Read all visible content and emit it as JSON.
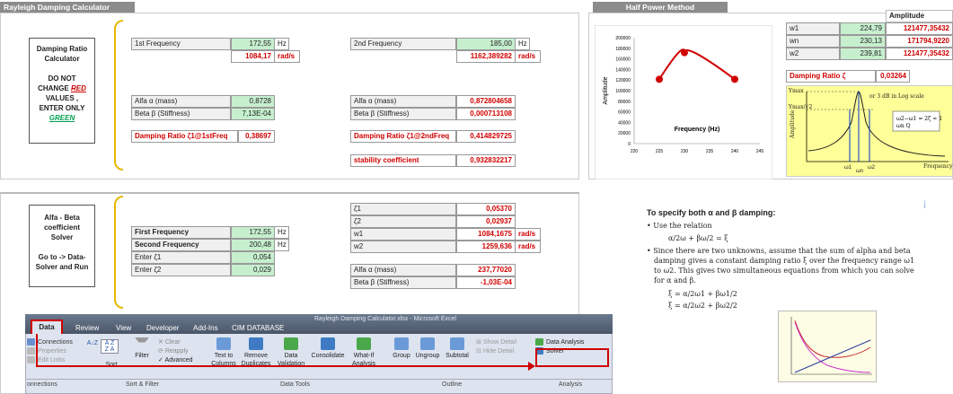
{
  "top_left": {
    "title": "Rayleigh Damping Calculator",
    "desc": [
      "Damping Ratio",
      "Calculator",
      "",
      "DO NOT",
      "CHANGE",
      "RED",
      "VALUES ,",
      "ENTER ONLY",
      "GREEN"
    ],
    "f1_label": "1st Frequency",
    "f1_val": "172,55",
    "f1_unit": "Hz",
    "f1_rad": "1084,17",
    "f1_rad_unit": "rad/s",
    "alpha_label": "Alfa α (mass)",
    "alpha_val": "0,8728",
    "beta_label": "Beta β (Stiffness)",
    "beta_val": "7,13E-04",
    "dr_label": "Damping Ratio ζ1@1stFreq",
    "dr_val": "0,38697",
    "f2_label": "2nd Frequency",
    "f2_val": "185,00",
    "f2_unit": "Hz",
    "f2_rad": "1162,389282",
    "f2_rad_unit": "rad/s",
    "alpha2_label": "Alfa α (mass)",
    "alpha2_val": "0,872804658",
    "beta2_label": "Beta β (Stiffness)",
    "beta2_val": "0,000713108",
    "dr2_label": "Damping Ratio ζ1@2ndFreq",
    "dr2_val": "0,414829725",
    "stab_label": "stability coefficient",
    "stab_val": "0,932832217"
  },
  "half_power": {
    "title": "Half Power Method",
    "amp_header": "Amplitude",
    "rows": [
      {
        "k": "w1",
        "v": "224,79",
        "a": "121477,35432"
      },
      {
        "k": "wn",
        "v": "230,13",
        "a": "171794,9220"
      },
      {
        "k": "w2",
        "v": "239,81",
        "a": "121477,35432"
      }
    ],
    "dr_label": "Damping Ratio ζ",
    "dr_val": "0,03264"
  },
  "chart_data": {
    "type": "line",
    "x": [
      225,
      230,
      240
    ],
    "y": [
      121477.35,
      171794.92,
      121477.35
    ],
    "xlabel": "Frequency (Hz)",
    "ylabel": "Amplitude",
    "xticks": [
      "220",
      "225",
      "230",
      "235",
      "240",
      "245"
    ],
    "yticks": [
      "200000",
      "180000",
      "160000",
      "140000",
      "120000",
      "100000",
      "80000",
      "60000",
      "40000",
      "20000",
      "0"
    ],
    "xlim": [
      220,
      245
    ],
    "ylim": [
      0,
      200000
    ],
    "color": "#d00000"
  },
  "resonance": {
    "ymax": "Ymax",
    "ymax_sqrt": "Ymax/√2",
    "note": "or 3 dB in Log scale",
    "yaxis": "Amplitude",
    "xaxis": "Frequency",
    "w1": "ω1",
    "wn": "ωn",
    "w2": "ω2"
  },
  "bottom_left": {
    "desc": [
      "Alfa - Beta",
      "coefficient",
      "Solver",
      "",
      "Go to -> Data-",
      "Solver and Run"
    ],
    "ff_label": "First Frequency",
    "ff_val": "172,55",
    "ff_unit": "Hz",
    "sf_label": "Second Frequency",
    "sf_val": "200,48",
    "sf_unit": "Hz",
    "z1_label": "Enter ζ1",
    "z1_val": "0,054",
    "z2_label": "Enter ζ2",
    "z2_val": "0,029",
    "r_z1": "ζ1",
    "r_z1v": "0,05370",
    "r_z2": "ζ2",
    "r_z2v": "0,02937",
    "r_w1": "w1",
    "r_w1v": "1084,1675",
    "r_w1u": "rad/s",
    "r_w2": "w2",
    "r_w2v": "1259,636",
    "r_w2u": "rad/s",
    "r_alpha": "Alfa α (mass)",
    "r_alphav": "237,77020",
    "r_beta": "Beta β (Stiffness)",
    "r_betav": "-1,03E-04"
  },
  "text": {
    "heading": "To specify both α and β damping:",
    "b1": "Use the relation",
    "eq1": "α/2ω + βω/2 = ξ",
    "b2": "Since there are two unknowns, assume that the sum of alpha and beta damping gives a constant damping ratio ξ over the frequency range ω1 to ω2. This gives two simultaneous equations from which you can solve for α and β.",
    "eq2": "ξ = α/2ω1 + βω1/2",
    "eq3": "ξ = α/2ω2 + βω2/2"
  },
  "ribbon": {
    "window_title": "Rayleigh Damping Calculator.xlsx - Microsoft Excel",
    "tabs": [
      "Data",
      "Review",
      "View",
      "Developer",
      "Add-Ins",
      "CIM DATABASE"
    ],
    "connections": "Connections",
    "properties": "Properties",
    "edit_links": "Edit Links",
    "sort": "Sort",
    "filter": "Filter",
    "clear": "Clear",
    "reapply": "Reapply",
    "advanced": "Advanced",
    "text_to_columns": "Text to Columns",
    "remove_duplicates": "Remove Duplicates",
    "data_validation": "Data Validation",
    "consolidate": "Consolidate",
    "what_if": "What-If Analysis",
    "group": "Group",
    "ungroup": "Ungroup",
    "subtotal": "Subtotal",
    "show_detail": "Show Detail",
    "hide_detail": "Hide Detail",
    "data_analysis": "Data Analysis",
    "solver": "Solver",
    "groups": [
      "onnections",
      "Sort & Filter",
      "Data Tools",
      "Outline",
      "Analysis"
    ]
  }
}
